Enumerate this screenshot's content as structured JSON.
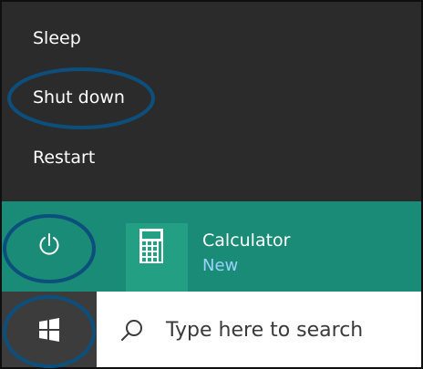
{
  "power_menu": {
    "items": [
      {
        "label": "Sleep"
      },
      {
        "label": "Shut down"
      },
      {
        "label": "Restart"
      }
    ]
  },
  "start_panel": {
    "tile": {
      "name": "Calculator",
      "badge": "New",
      "icon": "calculator-icon"
    },
    "power_icon": "power-icon"
  },
  "taskbar": {
    "start_icon": "windows-logo-icon",
    "search": {
      "placeholder": "Type here to search",
      "icon": "search-icon"
    }
  },
  "colors": {
    "menu_bg": "#2b2b2b",
    "start_accent": "#1a8b76",
    "tile_bg": "#239f83",
    "taskbar_bg": "#3c3c3c",
    "badge_text": "#9bd1ff",
    "highlight_circle": "#0d4f7c"
  }
}
